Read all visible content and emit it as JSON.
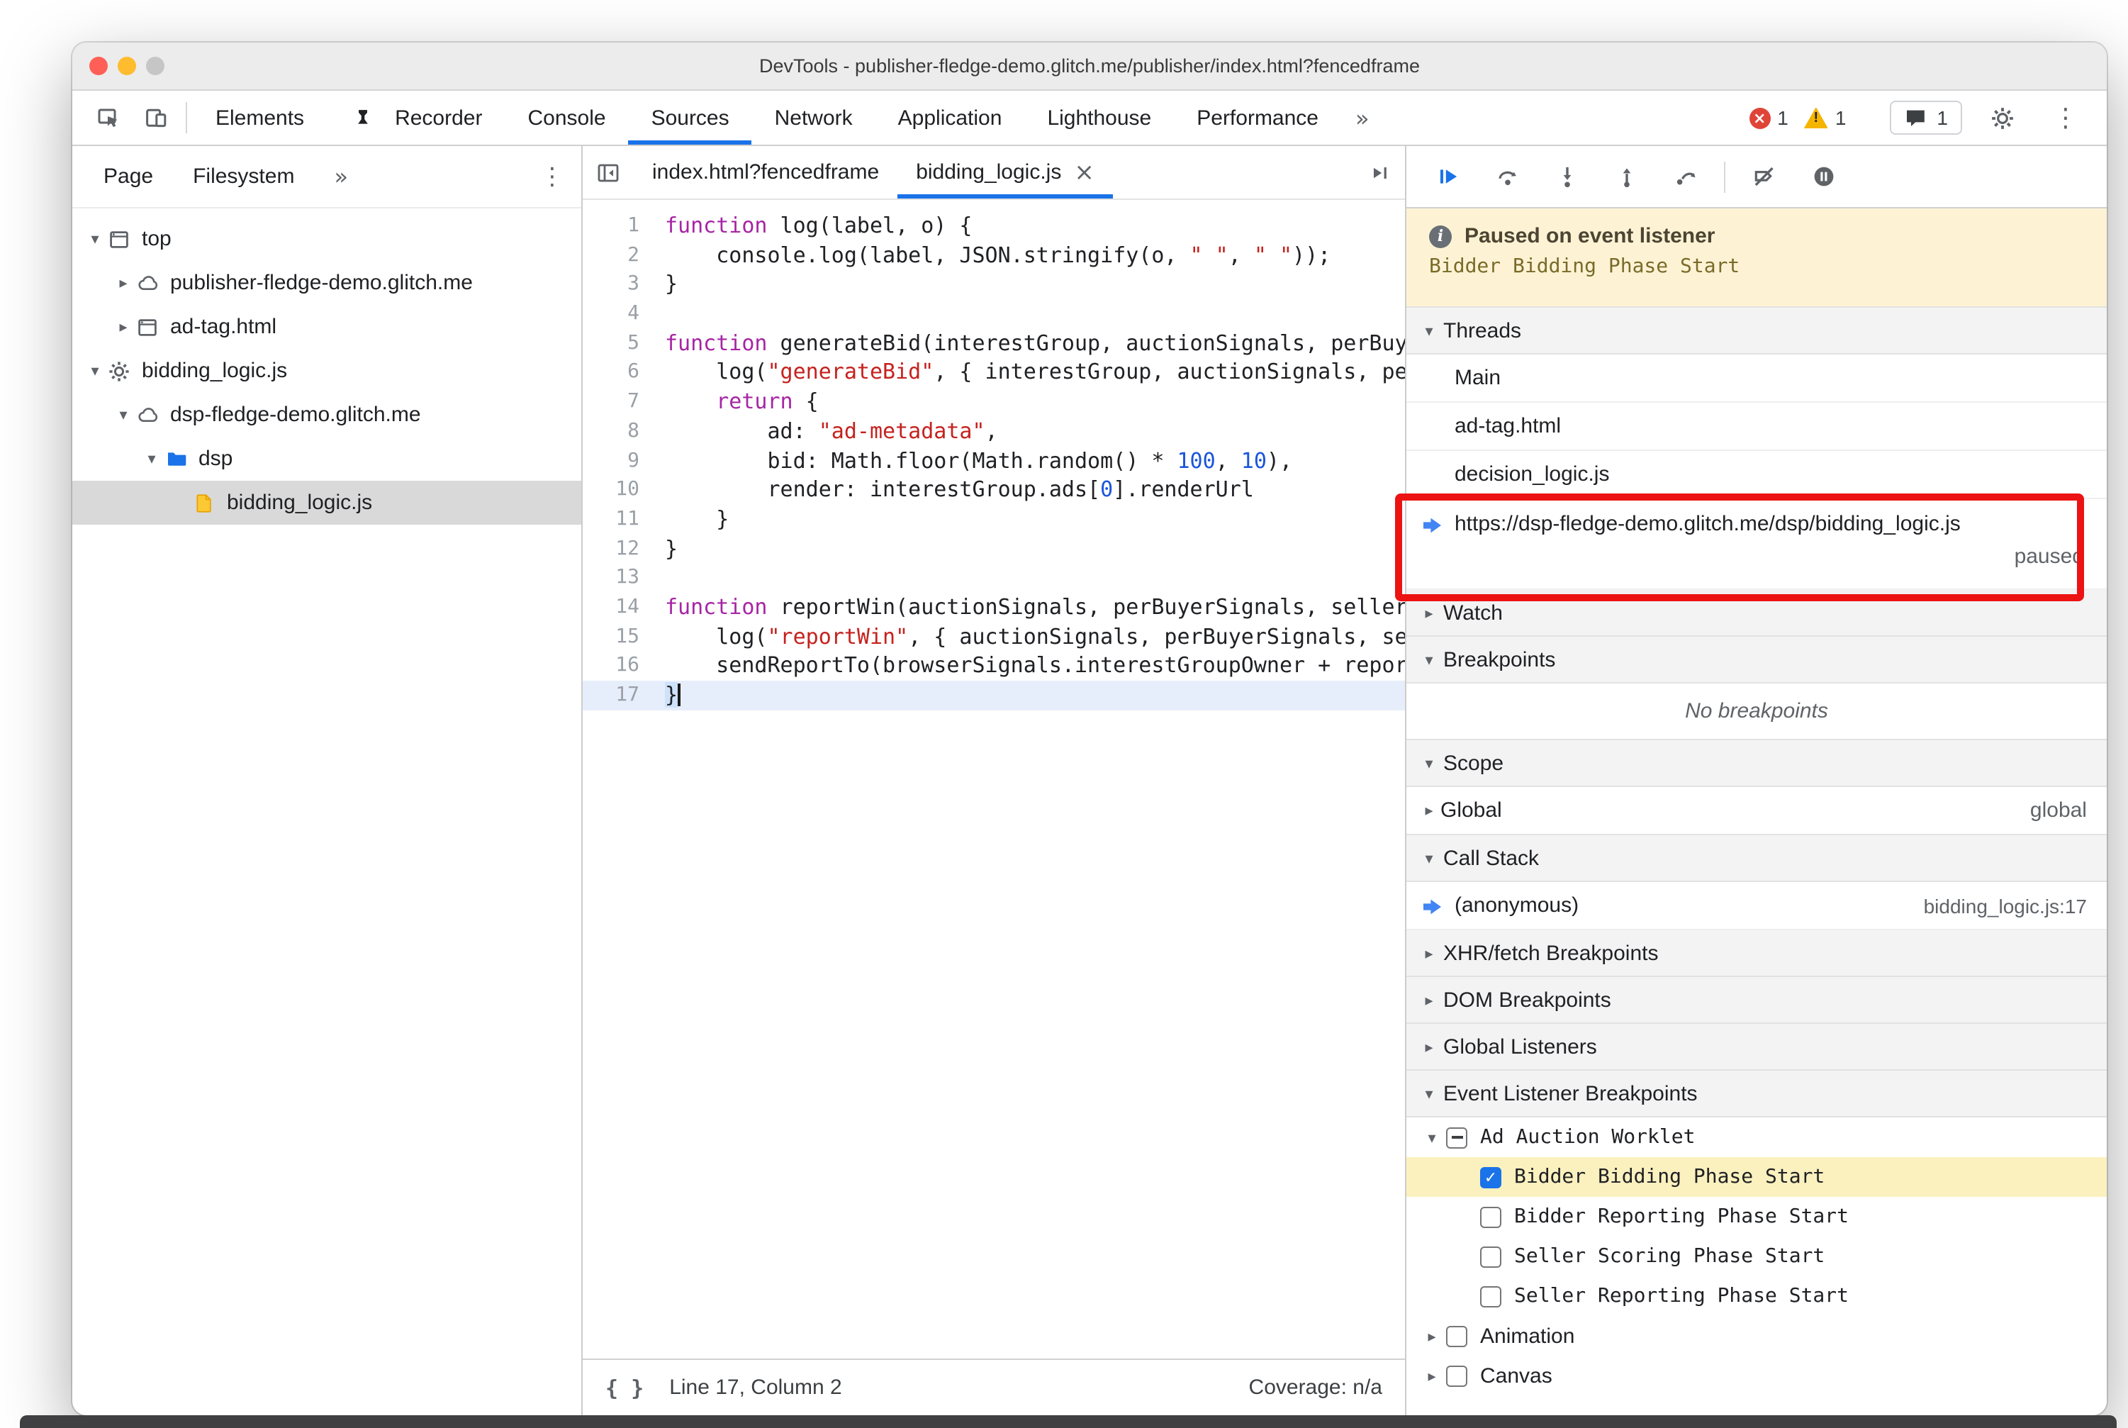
{
  "window": {
    "title": "DevTools - publisher-fledge-demo.glitch.me/publisher/index.html?fencedframe"
  },
  "colors": {
    "accent_blue": "#1a73e8",
    "annotation_red": "#ec1313",
    "paused_banner_bg": "#fdf3d4",
    "breakpoint_highlight_yellow": "#fbf1bf",
    "selection_gray": "#d9d9d9",
    "keyword_purple": "#a626a4",
    "string_red": "#c5221f",
    "number_blue": "#1a56db"
  },
  "toolbar": {
    "tabs": [
      {
        "label": "Elements"
      },
      {
        "label": "Recorder",
        "icon": "recorder"
      },
      {
        "label": "Console"
      },
      {
        "label": "Sources",
        "active": true
      },
      {
        "label": "Network"
      },
      {
        "label": "Application"
      },
      {
        "label": "Lighthouse"
      },
      {
        "label": "Performance"
      }
    ],
    "more_label": "»",
    "errors_count": "1",
    "warnings_count": "1",
    "issues_count": "1",
    "warning_glyph": "!",
    "error_glyph": "×"
  },
  "navigator": {
    "tabs": [
      {
        "label": "Page",
        "active": true
      },
      {
        "label": "Filesystem"
      }
    ],
    "more_label": "»",
    "tree": [
      {
        "label": "top",
        "depth": 0,
        "arrow": "expanded",
        "icon": "frame"
      },
      {
        "label": "publisher-fledge-demo.glitch.me",
        "depth": 1,
        "arrow": "collapsed",
        "icon": "cloud"
      },
      {
        "label": "ad-tag.html",
        "depth": 1,
        "arrow": "collapsed",
        "icon": "frame"
      },
      {
        "label": "bidding_logic.js",
        "depth": 0,
        "arrow": "expanded",
        "icon": "gear"
      },
      {
        "label": "dsp-fledge-demo.glitch.me",
        "depth": 1,
        "arrow": "expanded",
        "icon": "cloud"
      },
      {
        "label": "dsp",
        "depth": 2,
        "arrow": "expanded",
        "icon": "folder"
      },
      {
        "label": "bidding_logic.js",
        "depth": 3,
        "arrow": "none",
        "icon": "filejs",
        "selected": true
      }
    ]
  },
  "editor": {
    "tabs": [
      {
        "label": "index.html?fencedframe"
      },
      {
        "label": "bidding_logic.js",
        "active": true,
        "closable": true
      }
    ],
    "close_glyph": "×",
    "lines": [
      {
        "n": 1,
        "t": [
          [
            "k",
            "function"
          ],
          [
            "p",
            " log(label, o) {"
          ]
        ]
      },
      {
        "n": 2,
        "t": [
          [
            "p",
            "    console.log(label, JSON.stringify(o, "
          ],
          [
            "s",
            "\" \""
          ],
          [
            "p",
            ", "
          ],
          [
            "s",
            "\" \""
          ],
          [
            "p",
            "));"
          ]
        ]
      },
      {
        "n": 3,
        "t": [
          [
            "p",
            "}"
          ]
        ]
      },
      {
        "n": 4,
        "t": []
      },
      {
        "n": 5,
        "t": [
          [
            "k",
            "function"
          ],
          [
            "p",
            " generateBid(interestGroup, auctionSignals, perBuyerSignals"
          ]
        ]
      },
      {
        "n": 6,
        "t": [
          [
            "p",
            "    log("
          ],
          [
            "s",
            "\"generateBid\""
          ],
          [
            "p",
            ", { interestGroup, auctionSignals, perBuyerSign"
          ]
        ]
      },
      {
        "n": 7,
        "t": [
          [
            "p",
            "    "
          ],
          [
            "k",
            "return"
          ],
          [
            "p",
            " {"
          ]
        ]
      },
      {
        "n": 8,
        "t": [
          [
            "p",
            "        ad: "
          ],
          [
            "s",
            "\"ad-metadata\""
          ],
          [
            "p",
            ","
          ]
        ]
      },
      {
        "n": 9,
        "t": [
          [
            "p",
            "        bid: Math.floor(Math.random() * "
          ],
          [
            "d",
            "100"
          ],
          [
            "p",
            ", "
          ],
          [
            "d",
            "10"
          ],
          [
            "p",
            "),"
          ]
        ]
      },
      {
        "n": 10,
        "t": [
          [
            "p",
            "        render: interestGroup.ads["
          ],
          [
            "d",
            "0"
          ],
          [
            "p",
            "].renderUrl"
          ]
        ]
      },
      {
        "n": 11,
        "t": [
          [
            "p",
            "    }"
          ]
        ]
      },
      {
        "n": 12,
        "t": [
          [
            "p",
            "}"
          ]
        ]
      },
      {
        "n": 13,
        "t": []
      },
      {
        "n": 14,
        "t": [
          [
            "k",
            "function"
          ],
          [
            "p",
            " reportWin(auctionSignals, perBuyerSignals, sellerSignals"
          ]
        ]
      },
      {
        "n": 15,
        "t": [
          [
            "p",
            "    log("
          ],
          [
            "s",
            "\"reportWin\""
          ],
          [
            "p",
            ", { auctionSignals, perBuyerSignals, sellerSi"
          ]
        ]
      },
      {
        "n": 16,
        "t": [
          [
            "p",
            "    sendReportTo(browserSignals.interestGroupOwner + reportUrl"
          ]
        ]
      },
      {
        "n": 17,
        "t": [
          [
            "p",
            "}"
          ]
        ],
        "current": true
      }
    ],
    "status": {
      "line_col": "Line 17, Column 2",
      "coverage": "Coverage: n/a",
      "braces_glyph": "{ }"
    }
  },
  "debugger": {
    "banner": {
      "title": "Paused on event listener",
      "subtitle": "Bidder Bidding Phase Start",
      "info_glyph": "i"
    },
    "threads": {
      "title": "Threads",
      "items": [
        {
          "label": "Main"
        },
        {
          "label": "ad-tag.html"
        },
        {
          "label": "decision_logic.js"
        },
        {
          "label": "https://dsp-fledge-demo.glitch.me/dsp/bidding_logic.js",
          "status": "paused",
          "current": true,
          "annotated": true
        }
      ]
    },
    "watch": {
      "title": "Watch",
      "expanded": false
    },
    "breakpoints": {
      "title": "Breakpoints",
      "expanded": true,
      "empty_text": "No breakpoints"
    },
    "scope": {
      "title": "Scope",
      "expanded": true,
      "rows": [
        {
          "label": "Global",
          "value": "global"
        }
      ]
    },
    "call_stack": {
      "title": "Call Stack",
      "expanded": true,
      "rows": [
        {
          "label": "(anonymous)",
          "location": "bidding_logic.js:17",
          "current": true
        }
      ]
    },
    "xhr_breakpoints": {
      "title": "XHR/fetch Breakpoints",
      "expanded": false
    },
    "dom_breakpoints": {
      "title": "DOM Breakpoints",
      "expanded": false
    },
    "global_listeners": {
      "title": "Global Listeners",
      "expanded": false
    },
    "event_listener_breakpoints": {
      "title": "Event Listener Breakpoints",
      "expanded": true,
      "groups": [
        {
          "label": "Ad Auction Worklet",
          "checkbox": "indeterminate",
          "expanded": true,
          "mono": true,
          "children": [
            {
              "label": "Bidder Bidding Phase Start",
              "checked": true,
              "highlighted": true
            },
            {
              "label": "Bidder Reporting Phase Start",
              "checked": false
            },
            {
              "label": "Seller Scoring Phase Start",
              "checked": false
            },
            {
              "label": "Seller Reporting Phase Start",
              "checked": false
            }
          ]
        },
        {
          "label": "Animation",
          "checkbox": "unchecked",
          "expanded": false,
          "children": []
        },
        {
          "label": "Canvas",
          "checkbox": "unchecked",
          "expanded": false,
          "children": []
        }
      ]
    }
  },
  "icons": {
    "inspect": "cursor-in-box",
    "device-toolbar": "phone-and-tablet",
    "recorder": "dark-flask",
    "errors": "red-circle-x",
    "warnings": "yellow-triangle-exclaim",
    "issues": "speech-bubble",
    "settings": "gear ⚙",
    "menu": "kebab ⋮",
    "more-tabs": "»",
    "navigator-toggle": "panel-with-left-arrow",
    "open-file-nav": "panel-with-right-arrow",
    "resume": "blue-play ▶",
    "step-over": "arc-arrow-over-dot",
    "step-into": "arrow-down-to-dot",
    "step-out": "arrow-up-from-dot",
    "step": "arrow-from-dot",
    "deactivate-breakpoints": "breakpoint-tag-slash",
    "pause-on-exceptions": "pause-in-circle ⏸",
    "execution-arrow": "blue-right-arrow ➤",
    "chevron-expanded": "▾",
    "chevron-collapsed": "▸",
    "frame": "browser-frame-rect",
    "cloud": "cloud-outline",
    "gear": "gear-worklet",
    "folder": "blue-folder",
    "filejs": "yellow-file",
    "close-tab": "×",
    "pretty-print": "{ }",
    "info": "circled-i"
  }
}
